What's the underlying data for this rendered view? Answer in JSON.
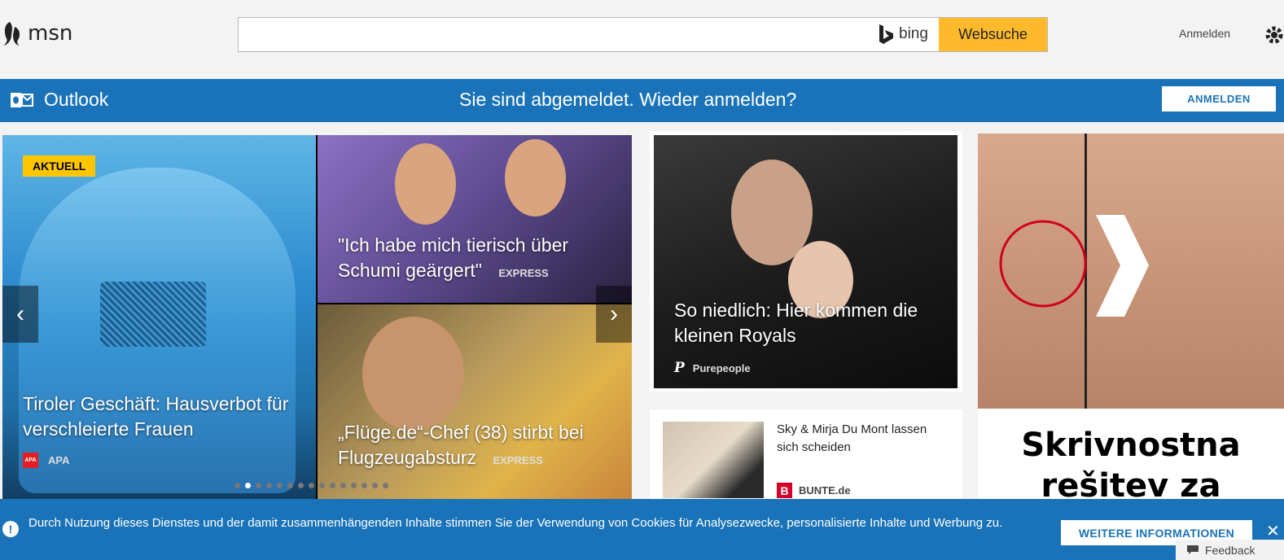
{
  "header": {
    "logo_text": "msn",
    "search_placeholder": "",
    "bing_label": "bing",
    "search_button": "Websuche",
    "signin_link": "Anmelden"
  },
  "outlook": {
    "label": "Outlook",
    "message": "Sie sind abgemeldet. Wieder anmelden?",
    "button": "ANMELDEN"
  },
  "carousel": {
    "badge": "AKTUELL",
    "main": {
      "title": "Tiroler Geschäft: Hausverbot für verschleierte Frauen",
      "source": "APA",
      "source_icon_text": "APA"
    },
    "top_right": {
      "title": "\"Ich habe mich tierisch über Schumi geärgert\"",
      "source": "EXPRESS"
    },
    "bottom_right": {
      "title": "„Flüge.de“-Chef (38) stirbt bei Flugzeugabsturz",
      "source": "EXPRESS"
    },
    "prev": "‹",
    "next": "›",
    "dot_count": 15,
    "active_dot": 1
  },
  "royal_card": {
    "title": "So niedlich: Hier kommen die kleinen Royals",
    "source": "Purepeople",
    "source_icon_text": "P"
  },
  "news_card": {
    "title": "Sky & Mirja Du Mont lassen sich scheiden",
    "source": "BUNTE.de",
    "source_icon_text": "B"
  },
  "ad": {
    "text": "Skrivnostna rešitev za"
  },
  "cookie": {
    "icon_text": "!",
    "text": "Durch Nutzung dieses Dienstes und der damit zusammenhängenden Inhalte stimmen Sie der Verwendung von Cookies für Analysezwecke, personalisierte Inhalte und Werbung zu.",
    "button": "WEITERE INFORMATIONEN",
    "close": "✕"
  },
  "feedback": {
    "label": "Feedback"
  },
  "colors": {
    "brand_blue": "#1a73b8",
    "search_button": "#ffba2b",
    "badge": "#ffc600"
  }
}
